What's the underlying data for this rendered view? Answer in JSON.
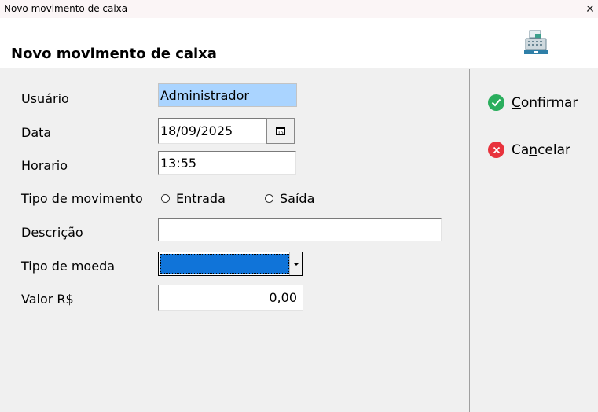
{
  "window": {
    "title": "Novo movimento de caixa",
    "close_glyph": "✕"
  },
  "header": {
    "heading": "Novo movimento de caixa",
    "icon": "cash-register-icon"
  },
  "form": {
    "usuario": {
      "label": "Usuário",
      "value": "Administrador"
    },
    "data": {
      "label": "Data",
      "value": "18/09/2025",
      "button_glyph": "15"
    },
    "horario": {
      "label": "Horario",
      "value": "13:55"
    },
    "tipo_movimento": {
      "label": "Tipo de movimento",
      "options": [
        "Entrada",
        "Saída"
      ]
    },
    "descricao": {
      "label": "Descrição",
      "value": ""
    },
    "tipo_moeda": {
      "label": "Tipo de moeda",
      "value": ""
    },
    "valor": {
      "label": "Valor R$",
      "value": "0,00"
    }
  },
  "actions": {
    "confirm": {
      "label_pre": "",
      "label_key": "C",
      "label_post": "onfirmar"
    },
    "cancel": {
      "label_pre": "Ca",
      "label_key": "n",
      "label_post": "celar"
    }
  },
  "colors": {
    "selected_field": "#aad4ff",
    "combo_highlight": "#1074d9",
    "confirm": "#2aae5d",
    "cancel": "#e8333d"
  }
}
